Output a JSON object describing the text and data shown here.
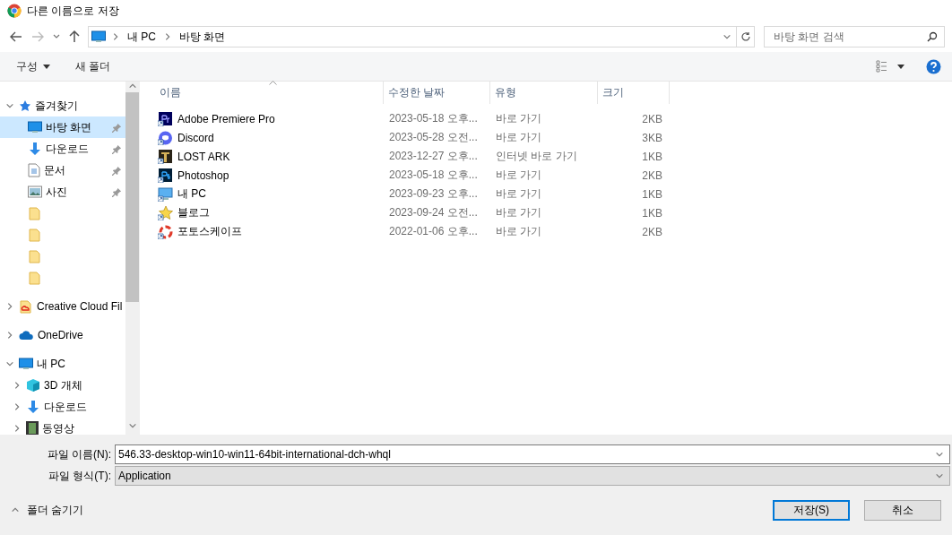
{
  "window": {
    "title": "다른 이름으로 저장"
  },
  "address": {
    "path": [
      "내 PC",
      "바탕 화면"
    ]
  },
  "search": {
    "placeholder": "바탕 화면 검색"
  },
  "toolbar": {
    "organize": "구성",
    "new_folder": "새 폴더"
  },
  "sidebar": {
    "items": [
      {
        "label": "즐겨찾기",
        "expanded": true,
        "selected": false,
        "children": [
          {
            "label": "바탕 화면",
            "pinned": true,
            "selected": true
          },
          {
            "label": "다운로드",
            "pinned": true,
            "selected": false
          },
          {
            "label": "문서",
            "pinned": true,
            "selected": false
          },
          {
            "label": "사진",
            "pinned": true,
            "selected": false
          },
          {
            "pinned": false,
            "selected": false
          },
          {
            "pinned": false,
            "selected": false
          },
          {
            "pinned": false,
            "selected": false
          },
          {
            "pinned": false,
            "selected": false
          }
        ]
      },
      {
        "label": "Creative Cloud Fil",
        "expanded": false,
        "selected": false
      },
      {
        "label": "OneDrive",
        "expanded": false,
        "selected": false
      },
      {
        "label": "내 PC",
        "expanded": true,
        "selected": false,
        "children": [
          {
            "label": "3D 개체",
            "expanded": false,
            "selected": false
          },
          {
            "label": "다운로드",
            "expanded": false,
            "selected": false
          },
          {
            "label": "동영상",
            "expanded": false,
            "selected": false
          }
        ]
      }
    ]
  },
  "table": {
    "columns": [
      {
        "label": "이름",
        "sorted": true
      },
      {
        "label": "수정한 날짜",
        "sorted": false
      },
      {
        "label": "유형",
        "sorted": false
      },
      {
        "label": "크기",
        "sorted": false
      }
    ],
    "rows": [
      {
        "name": "Adobe Premiere Pro",
        "date": "2023-05-18 오후...",
        "type": "바로 가기",
        "size": "2KB",
        "selected": false
      },
      {
        "name": "Discord",
        "date": "2023-05-28 오전...",
        "type": "바로 가기",
        "size": "3KB",
        "selected": false
      },
      {
        "name": "LOST ARK",
        "date": "2023-12-27 오후...",
        "type": "인터넷 바로 가기",
        "size": "1KB",
        "selected": false
      },
      {
        "name": "Photoshop",
        "date": "2023-05-18 오후...",
        "type": "바로 가기",
        "size": "2KB",
        "selected": false
      },
      {
        "name": "내 PC",
        "date": "2023-09-23 오후...",
        "type": "바로 가기",
        "size": "1KB",
        "selected": false
      },
      {
        "name": "블로그",
        "date": "2023-09-24 오전...",
        "type": "바로 가기",
        "size": "1KB",
        "selected": false
      },
      {
        "name": "포토스케이프",
        "date": "2022-01-06 오후...",
        "type": "바로 가기",
        "size": "2KB",
        "selected": false
      }
    ]
  },
  "form": {
    "fields": [
      {
        "label": "파일 이름(N):",
        "value": "546.33-desktop-win10-win11-64bit-international-dch-whql",
        "kind": "editable"
      },
      {
        "label": "파일 형식(T):",
        "value": "Application",
        "kind": "readonly"
      }
    ]
  },
  "hide_folders": "폴더 숨기기",
  "buttons": [
    {
      "label": "저장(S)",
      "default": true
    },
    {
      "label": "취소",
      "default": false
    }
  ]
}
